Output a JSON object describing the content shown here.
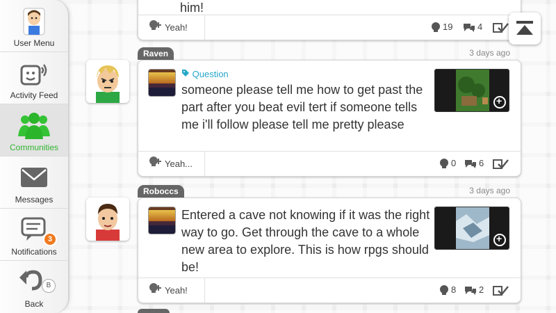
{
  "sidebar": {
    "items": [
      {
        "label": "User Menu",
        "icon": "user-mii-icon"
      },
      {
        "label": "Activity Feed",
        "icon": "activity-feed-icon"
      },
      {
        "label": "Communities",
        "icon": "communities-icon",
        "active": true
      },
      {
        "label": "Messages",
        "icon": "envelope-icon"
      },
      {
        "label": "Notifications",
        "icon": "notification-bubble-icon",
        "badge": "3"
      },
      {
        "label": "Back",
        "icon": "back-arrow-icon",
        "button_hint": "B"
      }
    ],
    "active_color": "#31b531",
    "badge_color": "#f07a1f"
  },
  "top_post": {
    "text": "him!",
    "yeah_label": "Yeah!",
    "yeahs": "19",
    "comments": "4"
  },
  "posts": [
    {
      "author": "Raven",
      "time": "3 days ago",
      "tag": "Question",
      "text": "someone please tell me how to get past the part after you beat evil tert if someone tells me i'll follow please tell me pretty please",
      "yeah_label": "Yeah...",
      "yeahs": "0",
      "comments": "6"
    },
    {
      "author": "Roboccs",
      "time": "3 days ago",
      "text": "Entered a cave not knowing if it was the right way to go. Get through the cave to a whole new area to explore. This is how rpgs should be!",
      "yeah_label": "Yeah!",
      "yeahs": "8",
      "comments": "2"
    }
  ],
  "colors": {
    "tag": "#27a8c9",
    "author_tab": "#666666"
  }
}
